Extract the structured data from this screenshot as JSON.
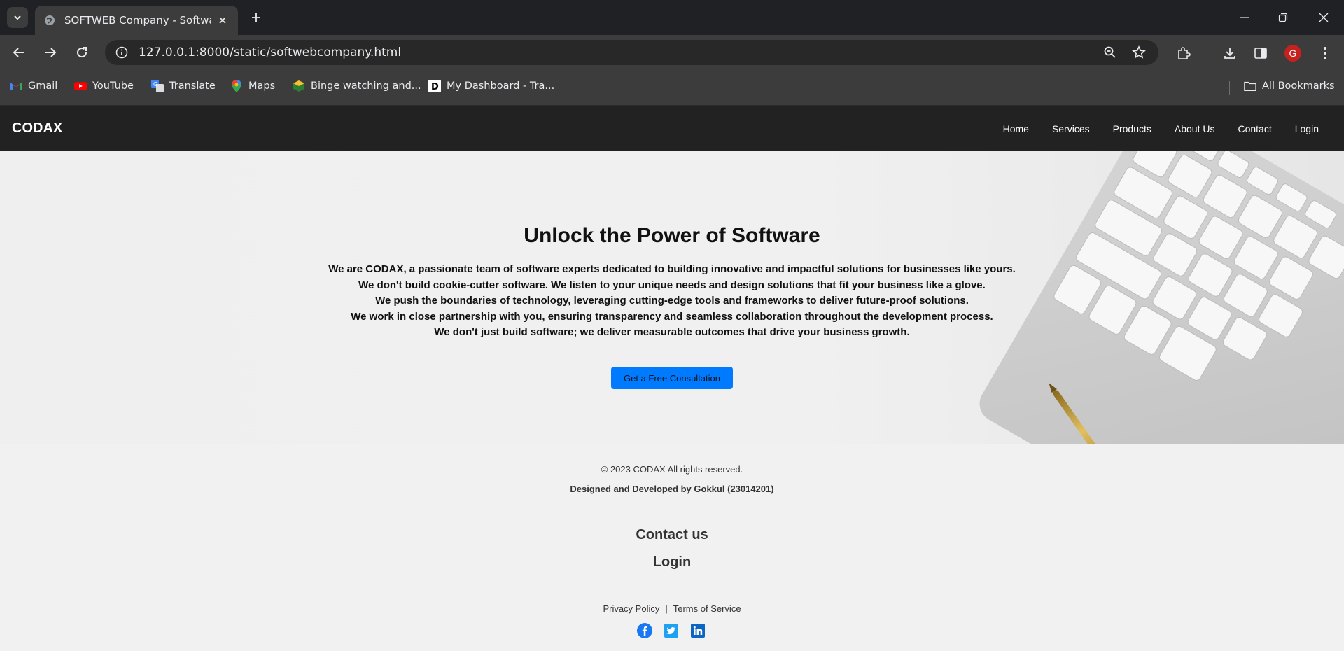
{
  "browser": {
    "tab_title": "SOFTWEB Company - Software",
    "url": "127.0.0.1:8000/static/softwebcompany.html",
    "avatar_letter": "G",
    "bookmarks": [
      {
        "label": "Gmail",
        "icon": "gmail-icon"
      },
      {
        "label": "YouTube",
        "icon": "youtube-icon"
      },
      {
        "label": "Translate",
        "icon": "translate-icon"
      },
      {
        "label": "Maps",
        "icon": "maps-icon"
      },
      {
        "label": "Binge watching and...",
        "icon": "binge-icon"
      },
      {
        "label": "My Dashboard - Tra...",
        "icon": "dashboard-icon"
      }
    ],
    "all_bookmarks": "All Bookmarks"
  },
  "site": {
    "logo": "CODAX",
    "nav": [
      "Home",
      "Services",
      "Products",
      "About Us",
      "Contact",
      "Login"
    ]
  },
  "hero": {
    "title": "Unlock the Power of Software",
    "lines": [
      "We are CODAX, a passionate team of software experts dedicated to building innovative and impactful solutions for businesses like yours.",
      "We don't build cookie-cutter software. We listen to your unique needs and design solutions that fit your business like a glove.",
      "We push the boundaries of technology, leveraging cutting-edge tools and frameworks to deliver future-proof solutions.",
      "We work in close partnership with you, ensuring transparency and seamless collaboration throughout the development process.",
      "We don't just build software; we deliver measurable outcomes that drive your business growth."
    ],
    "cta": "Get a Free Consultation"
  },
  "footer": {
    "copyright": "© 2023  CODAX  All rights reserved.",
    "credits": "Designed and Developed by Gokkul (23014201)",
    "contact": "Contact us",
    "login": "Login",
    "privacy": "Privacy Policy",
    "separator": "|",
    "terms": "Terms of Service",
    "social": [
      "facebook-icon",
      "twitter-icon",
      "linkedin-icon"
    ]
  },
  "colors": {
    "accent": "#007bff",
    "header_bg": "#222222",
    "chrome_bg": "#3c3c3c"
  }
}
